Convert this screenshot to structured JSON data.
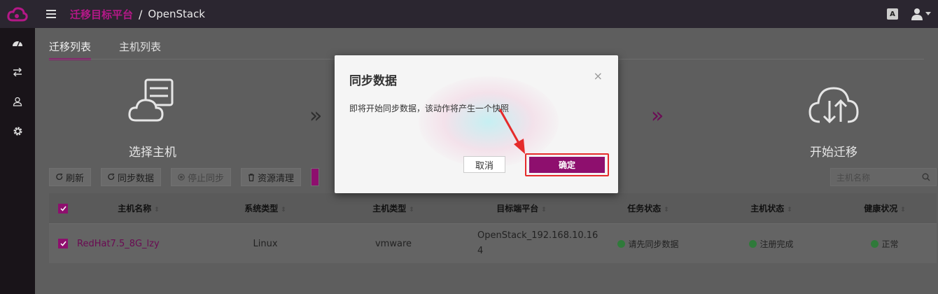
{
  "header": {
    "breadcrumb_section": "迁移目标平台",
    "breadcrumb_separator": "/",
    "breadcrumb_page": "OpenStack",
    "lang_label": "A"
  },
  "tabs": [
    {
      "label": "迁移列表",
      "active": true
    },
    {
      "label": "主机列表",
      "active": false
    }
  ],
  "steps": {
    "step1_label": "选择主机",
    "step4_label": "开始迁移"
  },
  "toolbar": {
    "refresh": "刷新",
    "sync_data": "同步数据",
    "stop_sync": "停止同步",
    "resource_cleanup": "资源清理"
  },
  "search": {
    "placeholder": "主机名称"
  },
  "table": {
    "columns": [
      "主机名称",
      "系统类型",
      "主机类型",
      "目标端平台",
      "任务状态",
      "主机状态",
      "健康状况"
    ],
    "rows": [
      {
        "host_name": "RedHat7.5_8G_lzy",
        "os_type": "Linux",
        "host_type": "vmware",
        "target_platform_line1": "OpenStack_192.168.10.16",
        "target_platform_line2": "4",
        "task_status": "请先同步数据",
        "host_status": "注册完成",
        "health": "正常"
      }
    ]
  },
  "modal": {
    "title": "同步数据",
    "close": "×",
    "message": "即将开始同步数据，该动作将产生一个快照",
    "cancel_label": "取消",
    "confirm_label": "确定"
  },
  "colors": {
    "brand": "#8e0f6e",
    "highlight": "#e52b2b",
    "ok_status": "#2f7a3a"
  }
}
